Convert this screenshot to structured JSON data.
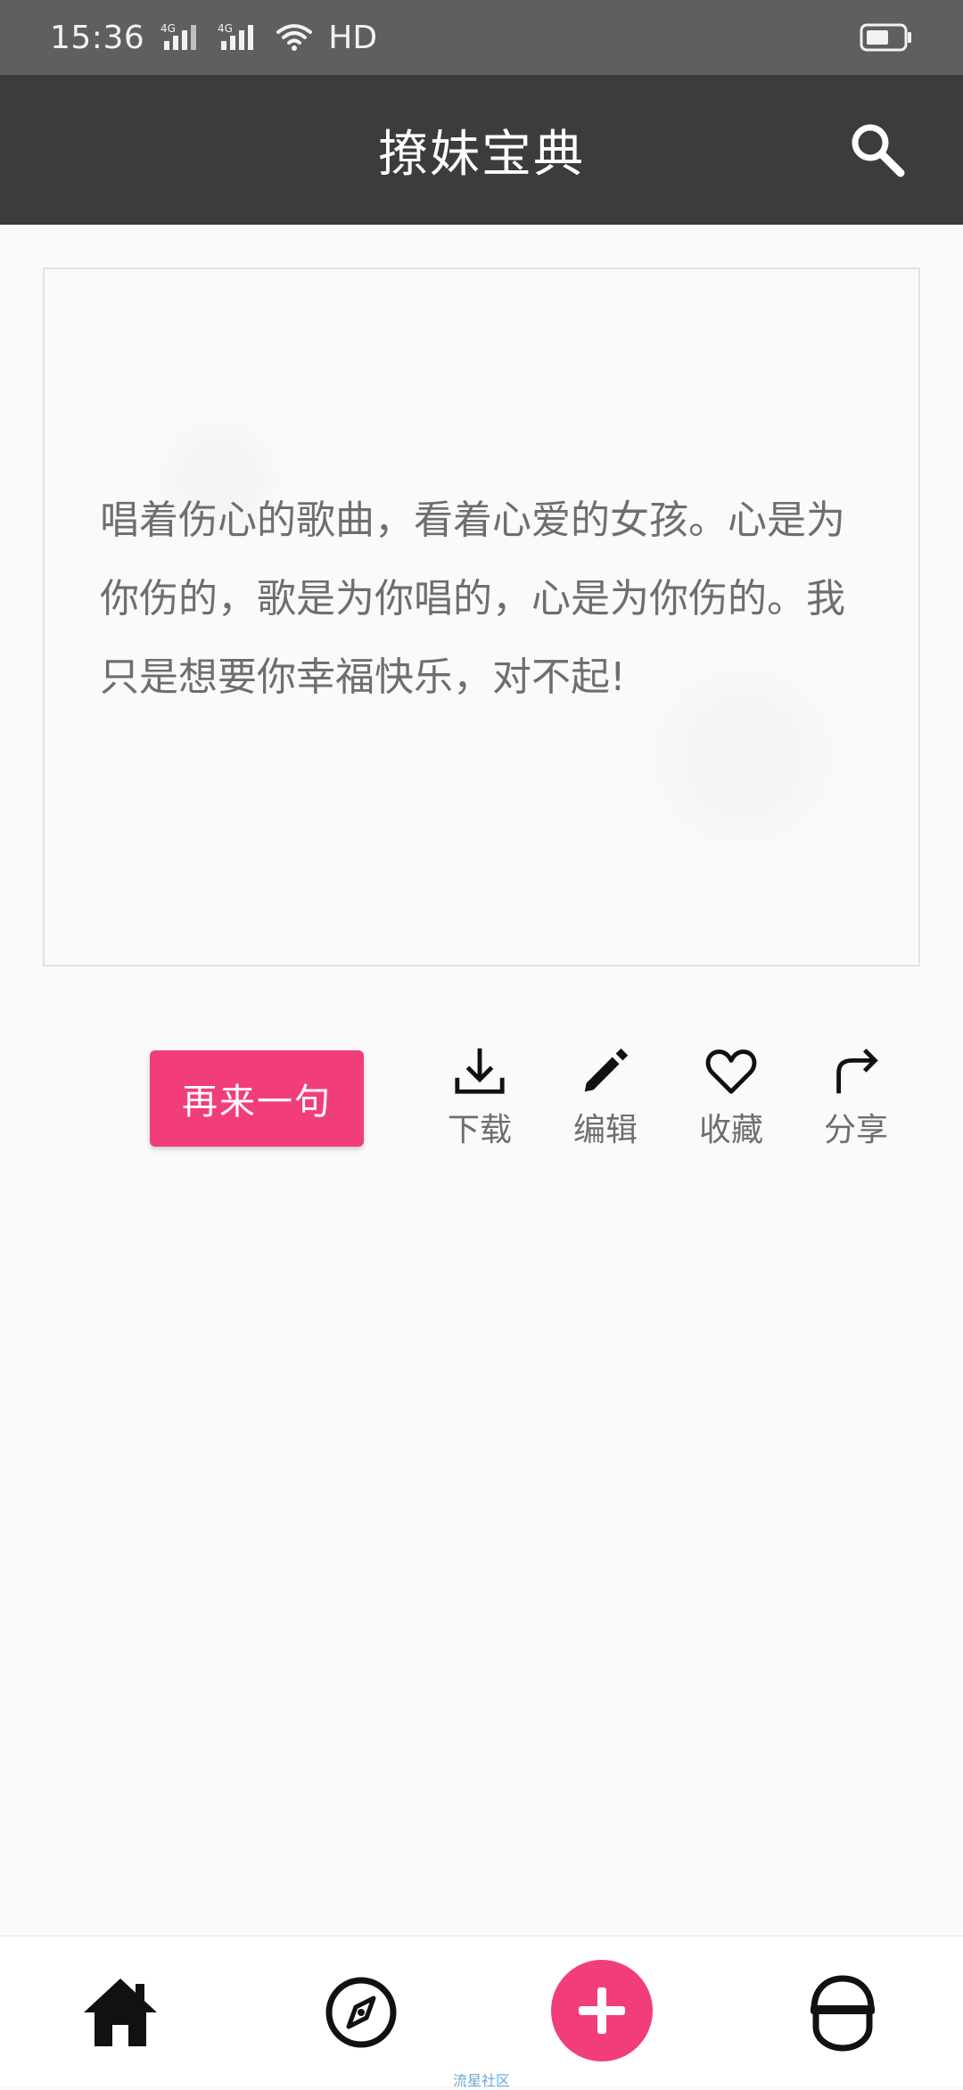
{
  "status_bar": {
    "time": "15:36",
    "network_1": "4G",
    "network_2": "4G",
    "hd_label": "HD"
  },
  "app_bar": {
    "title": "撩妹宝典"
  },
  "quote": {
    "text": "唱着伤心的歌曲，看着心爱的女孩。心是为你伤的，歌是为你唱的，心是为你伤的。我只是想要你幸福快乐，对不起!"
  },
  "actions": {
    "again_label": "再来一句",
    "download_label": "下载",
    "edit_label": "编辑",
    "favorite_label": "收藏",
    "share_label": "分享"
  },
  "bottom_nav": {
    "fab_caption": "流星社区"
  },
  "colors": {
    "accent": "#f23d7c",
    "app_bar": "#3c3c3c",
    "status_bar": "#5f5f5f"
  }
}
